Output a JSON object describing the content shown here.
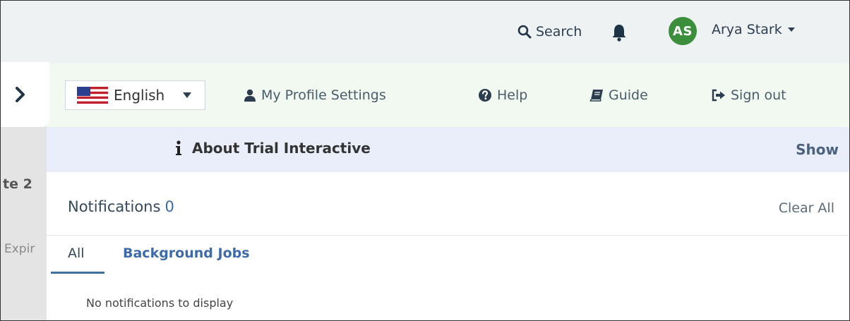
{
  "header": {
    "search_label": "Search",
    "avatar_initials": "AS",
    "avatar_color": "#3b8e3c",
    "user_name": "Arya Stark"
  },
  "background_page": {
    "fragment_1": "te 2",
    "fragment_2": "Expir"
  },
  "menu": {
    "language": "English",
    "profile_settings": "My Profile Settings",
    "help": "Help",
    "guide": "Guide",
    "sign_out": "Sign out"
  },
  "about": {
    "title": "About Trial Interactive",
    "toggle": "Show"
  },
  "notifications": {
    "title": "Notifications",
    "count": "0",
    "clear_all": "Clear All",
    "tabs": [
      {
        "label": "All",
        "active": true
      },
      {
        "label": "Background Jobs",
        "active": false
      }
    ],
    "empty_message": "No notifications to display"
  },
  "colors": {
    "topbar_bg": "#eef2f3",
    "menu_bg": "#f1f9f0",
    "about_bg": "#e9eefa",
    "accent": "#3d6aa8"
  },
  "icons": {
    "search": "search-icon",
    "bell": "bell-icon",
    "expand": "chevron-right-icon",
    "flag": "us-flag-icon",
    "user": "user-icon",
    "help": "question-circle-icon",
    "guide": "book-icon",
    "sign_out": "sign-out-icon",
    "info": "info-icon"
  }
}
